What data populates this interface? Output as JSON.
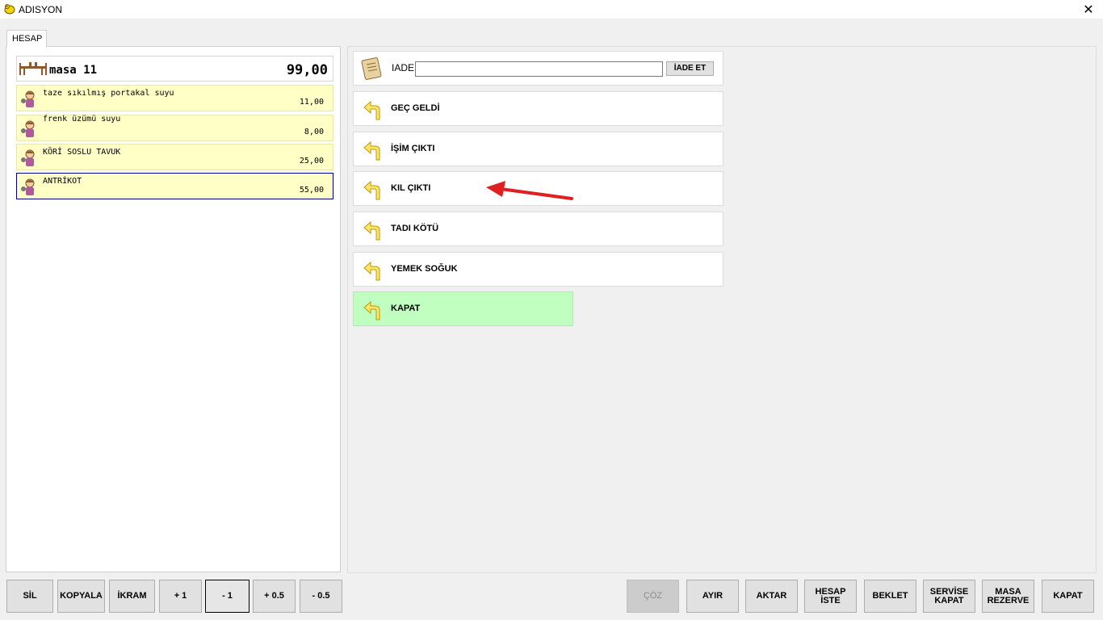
{
  "window": {
    "title": "ADISYON",
    "close_glyph": "✕"
  },
  "tab": {
    "label": "HESAP"
  },
  "order": {
    "table_name": "masa 11",
    "total": "99,00",
    "items": [
      {
        "name": "taze sıkılmış portakal suyu",
        "price": "11,00"
      },
      {
        "name": "frenk üzümü suyu",
        "price": "8,00"
      },
      {
        "name": "KÖRİ SOSLU TAVUK",
        "price": "25,00"
      },
      {
        "name": "ANTRİKOT",
        "price": "55,00"
      }
    ]
  },
  "iade": {
    "label": "IADE",
    "value": "",
    "button": "İADE ET"
  },
  "reasons": [
    {
      "label": "GEÇ GELDİ"
    },
    {
      "label": "İŞİM ÇIKTI"
    },
    {
      "label": "KIL ÇIKTI"
    },
    {
      "label": "TADI KÖTÜ"
    },
    {
      "label": "YEMEK SOĞUK"
    },
    {
      "label": "KAPAT"
    }
  ],
  "bottom_left": [
    {
      "label": "SİL"
    },
    {
      "label": "KOPYALA"
    },
    {
      "label": "İKRAM"
    },
    {
      "label": "+ 1"
    },
    {
      "label": "- 1"
    },
    {
      "label": "+ 0.5"
    },
    {
      "label": "- 0.5"
    }
  ],
  "bottom_right": [
    {
      "label": "ÇÖZ"
    },
    {
      "label": "AYIR"
    },
    {
      "label": "AKTAR"
    },
    {
      "label_1": "HESAP",
      "label_2": "İSTE"
    },
    {
      "label": "BEKLET"
    },
    {
      "label_1": "SERVİSE",
      "label_2": "KAPAT"
    },
    {
      "label_1": "MASA",
      "label_2": "REZERVE"
    },
    {
      "label": "KAPAT"
    }
  ],
  "icons": {
    "app": "yellow-chick-icon",
    "table": "dining-table-icon",
    "waiter": "waiter-icon",
    "note": "receipt-note-icon",
    "undo": "undo-arrow-icon",
    "annotation": "red-arrow-annotation"
  },
  "colors": {
    "item_background": "#ffffc6",
    "kapat_background": "#c0ffc0",
    "annotation_arrow": "#e02020",
    "selected_border": "#00008b"
  }
}
